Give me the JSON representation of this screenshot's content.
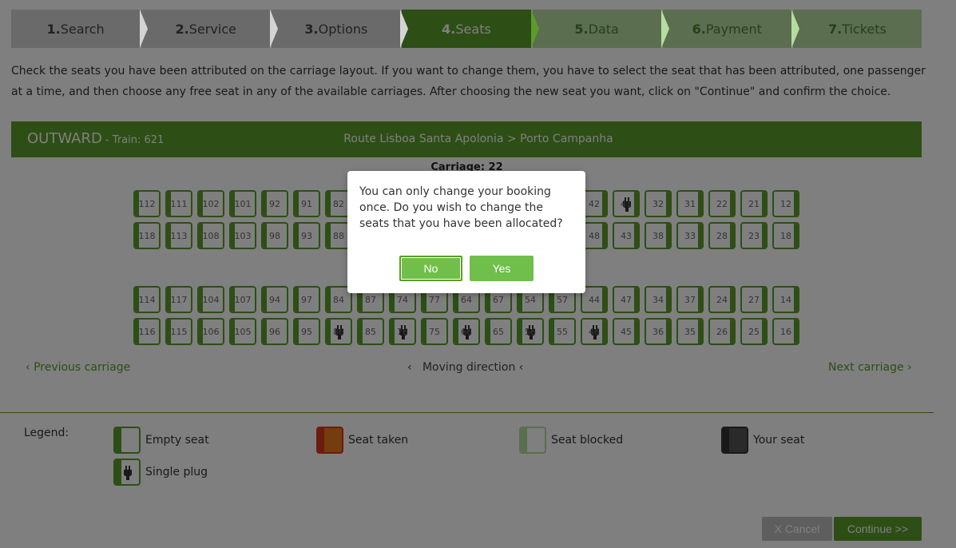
{
  "steps": [
    {
      "num": "1.",
      "label": "Search",
      "state": "done"
    },
    {
      "num": "2.",
      "label": "Service",
      "state": "done"
    },
    {
      "num": "3.",
      "label": "Options",
      "state": "done"
    },
    {
      "num": "4.",
      "label": "Seats",
      "state": "active"
    },
    {
      "num": "5.",
      "label": "Data",
      "state": "todo"
    },
    {
      "num": "6.",
      "label": "Payment",
      "state": "todo"
    },
    {
      "num": "7.",
      "label": "Tickets",
      "state": "todo"
    }
  ],
  "instructions": "Check the seats you have been attributed on the carriage layout. If you want to change them, you have to select the seat that has been attributed, one passenger at a time, and then choose any free seat in any of the available carriages. After choosing the new seat you want, click on \"Continue\" and confirm the choice.",
  "train": {
    "direction": "OUTWARD",
    "train_label": " - Train: 621",
    "route": "Route Lisboa Santa Apolonia > Porto Campanha"
  },
  "carriage": {
    "title": "Carriage: 22",
    "rows": [
      {
        "seats": [
          "112",
          "111",
          "102",
          "101",
          "92",
          "91",
          "82",
          "",
          "",
          "",
          "",
          "",
          "",
          "",
          "42",
          "41",
          "32",
          "31",
          "22",
          "21",
          "12"
        ],
        "plugs": [
          "41"
        ]
      },
      {
        "seats": [
          "118",
          "113",
          "108",
          "103",
          "98",
          "93",
          "88",
          "",
          "",
          "",
          "",
          "",
          "",
          "",
          "48",
          "43",
          "38",
          "33",
          "28",
          "23",
          "18"
        ],
        "plugs": []
      },
      {
        "seats": [
          "114",
          "117",
          "104",
          "107",
          "94",
          "97",
          "84",
          "87",
          "74",
          "77",
          "64",
          "67",
          "54",
          "57",
          "44",
          "47",
          "34",
          "37",
          "24",
          "27",
          "14"
        ],
        "plugs": []
      },
      {
        "seats": [
          "116",
          "115",
          "106",
          "105",
          "96",
          "95",
          "86",
          "85",
          "76",
          "75",
          "66",
          "65",
          "56",
          "55",
          "46",
          "45",
          "36",
          "35",
          "26",
          "25",
          "16"
        ],
        "plugs": [
          "86",
          "76",
          "66",
          "56",
          "46"
        ]
      }
    ]
  },
  "nav": {
    "prev": "Previous carriage",
    "direction": "Moving direction",
    "next": "Next carriage"
  },
  "legend": {
    "title": "Legend:",
    "items": [
      {
        "label": "Empty seat",
        "stripe": "#5b9c2b"
      },
      {
        "label": "Seat taken",
        "stripe": "#d9381e",
        "fill": "#e87a1d"
      },
      {
        "label": "Seat blocked",
        "stripe": "#b7dca0"
      },
      {
        "label": "Your seat",
        "stripe": "#333333",
        "fill": "#555555"
      },
      {
        "label": "Single plug",
        "stripe": "#5b9c2b"
      }
    ]
  },
  "buttons": {
    "cancel": "X Cancel",
    "continue": "Continue >>"
  },
  "modal": {
    "message": "You can only change your booking once. Do you wish to change the seats that you have been allocated?",
    "no": "No",
    "yes": "Yes"
  },
  "colors": {
    "brand_green": "#5b9c2b",
    "light_green": "#b7dca0",
    "button_green": "#6fbf4a"
  }
}
